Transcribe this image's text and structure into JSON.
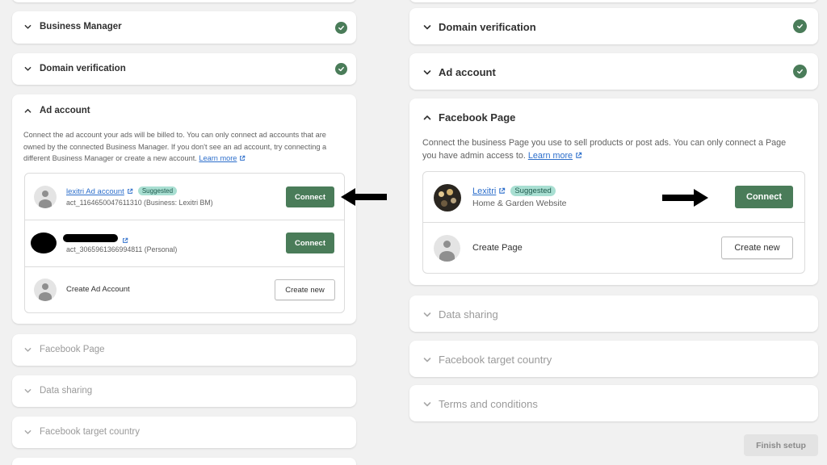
{
  "left_panel": {
    "business_manager": {
      "title": "Business Manager",
      "status": "complete"
    },
    "domain_verification": {
      "title": "Domain verification",
      "status": "complete"
    },
    "ad_account": {
      "title": "Ad account",
      "description": "Connect the ad account your ads will be billed to. You can only connect ad accounts that are owned by the connected Business Manager. If you don't see an ad account, try connecting a different Business Manager or create a new account.",
      "learn_more": "Learn more",
      "accounts": [
        {
          "name": "lexitri Ad account",
          "badge": "Suggested",
          "id": "act_1164650047611310 (Business: Lexitri BM)",
          "action": "Connect"
        },
        {
          "name": "",
          "id": "act_3065961366994811 (Personal)",
          "action": "Connect"
        }
      ],
      "create": {
        "label": "Create Ad Account",
        "action": "Create new"
      }
    },
    "facebook_page": {
      "title": "Facebook Page"
    },
    "data_sharing": {
      "title": "Data sharing"
    },
    "facebook_target_country": {
      "title": "Facebook target country"
    }
  },
  "right_panel": {
    "domain_verification": {
      "title": "Domain verification",
      "status": "complete"
    },
    "ad_account": {
      "title": "Ad account",
      "status": "complete"
    },
    "facebook_page": {
      "title": "Facebook Page",
      "description": "Connect the business Page you use to sell products or post ads. You can only connect a Page you have admin access to.",
      "learn_more": "Learn more",
      "page": {
        "name": "Lexitri",
        "badge": "Suggested",
        "category": "Home & Garden Website",
        "action": "Connect"
      },
      "create": {
        "label": "Create Page",
        "action": "Create new"
      }
    },
    "data_sharing": {
      "title": "Data sharing"
    },
    "facebook_target_country": {
      "title": "Facebook target country"
    },
    "terms": {
      "title": "Terms and conditions"
    },
    "finish": "Finish setup"
  },
  "colors": {
    "accent": "#4a7c59",
    "link": "#2c6ecb",
    "badge_bg": "#a9dfd2"
  }
}
